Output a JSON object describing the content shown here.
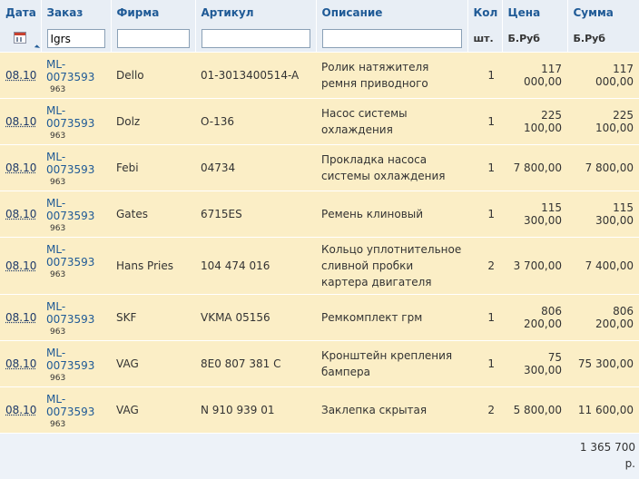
{
  "headers": {
    "date": "Дата",
    "order": "Заказ",
    "firm": "Фирма",
    "article": "Артикул",
    "description": "Описание",
    "qty": "Кол",
    "price": "Цена",
    "sum": "Сумма"
  },
  "subheaders": {
    "qty": "шт.",
    "price": "Б.Руб",
    "sum": "Б.Руб"
  },
  "filters": {
    "order": "Igrs",
    "firm": "",
    "article": "",
    "description": ""
  },
  "rows": [
    {
      "date": "08.10",
      "order": "ML-0073593",
      "order_sub": "963",
      "firm": "Dello",
      "article": "01-3013400514-A",
      "description": "Ролик натяжителя ремня приводного",
      "qty": "1",
      "price": "117 000,00",
      "sum": "117 000,00"
    },
    {
      "date": "08.10",
      "order": "ML-0073593",
      "order_sub": "963",
      "firm": "Dolz",
      "article": "O-136",
      "description": "Насос системы охлаждения",
      "qty": "1",
      "price": "225 100,00",
      "sum": "225 100,00"
    },
    {
      "date": "08.10",
      "order": "ML-0073593",
      "order_sub": "963",
      "firm": "Febi",
      "article": "04734",
      "description": "Прокладка насоса системы охлаждения",
      "qty": "1",
      "price": "7 800,00",
      "sum": "7 800,00"
    },
    {
      "date": "08.10",
      "order": "ML-0073593",
      "order_sub": "963",
      "firm": "Gates",
      "article": "6715ES",
      "description": "Ремень клиновый",
      "qty": "1",
      "price": "115 300,00",
      "sum": "115 300,00"
    },
    {
      "date": "08.10",
      "order": "ML-0073593",
      "order_sub": "963",
      "firm": "Hans Pries",
      "article": "104 474 016",
      "description": "Кольцо уплотнительное сливной пробки картера двигателя",
      "qty": "2",
      "price": "3 700,00",
      "sum": "7 400,00"
    },
    {
      "date": "08.10",
      "order": "ML-0073593",
      "order_sub": "963",
      "firm": "SKF",
      "article": "VKMA 05156",
      "description": "Ремкомплект грм",
      "qty": "1",
      "price": "806 200,00",
      "sum": "806 200,00"
    },
    {
      "date": "08.10",
      "order": "ML-0073593",
      "order_sub": "963",
      "firm": "VAG",
      "article": "8E0 807 381 C",
      "description": "Кронштейн крепления бампера",
      "qty": "1",
      "price": "75 300,00",
      "sum": "75 300,00"
    },
    {
      "date": "08.10",
      "order": "ML-0073593",
      "order_sub": "963",
      "firm": "VAG",
      "article": "N 910 939 01",
      "description": "Заклепка скрытая",
      "qty": "2",
      "price": "5 800,00",
      "sum": "11 600,00"
    }
  ],
  "total": {
    "value": "1 365 700",
    "unit": "р."
  }
}
